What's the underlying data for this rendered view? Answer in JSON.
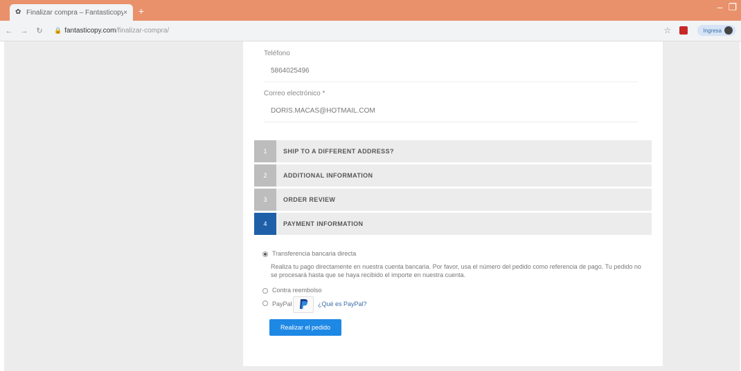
{
  "browser": {
    "tab_title": "Finalizar compra – Fantasticopy",
    "close_glyph": "×",
    "new_tab_glyph": "+",
    "url_host": "fantasticopy.com",
    "url_path": "/finalizar-compra/",
    "profile_label": "Ingresa"
  },
  "form": {
    "phone_label": "Teléfono",
    "phone_value": "5864025496",
    "email_label": "Correo electrónico *",
    "email_value": "DORIS.MACAS@HOTMAIL.COM"
  },
  "steps": [
    {
      "num": "1",
      "label": "SHIP TO A DIFFERENT ADDRESS?"
    },
    {
      "num": "2",
      "label": "ADDITIONAL INFORMATION"
    },
    {
      "num": "3",
      "label": "ORDER REVIEW"
    },
    {
      "num": "4",
      "label": "PAYMENT INFORMATION"
    }
  ],
  "payment": {
    "bank_transfer_label": "Transferencia bancaria directa",
    "bank_transfer_desc": "Realiza tu pago directamente en nuestra cuenta bancaria. Por favor, usa el número del pedido como referencia de pago. Tu pedido no se procesará hasta que se haya recibido el importe en nuestra cuenta.",
    "cod_label": "Contra reembolso",
    "paypal_label": "PayPal",
    "paypal_link": "¿Qué es PayPal?",
    "submit_label": "Realizar el pedido"
  },
  "colors": {
    "tabbar": "#e8916b",
    "active_step": "#1e5fa8",
    "button": "#1e88e5"
  }
}
